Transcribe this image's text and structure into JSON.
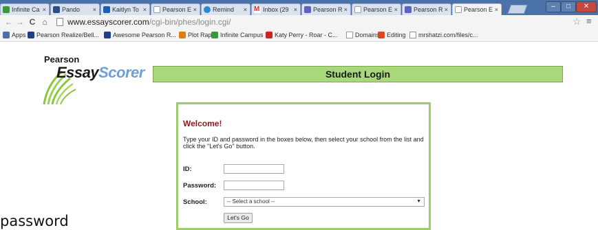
{
  "browser": {
    "tabs": [
      {
        "label": "Infinite Ca",
        "icon": "infinite-campus-icon",
        "color": "#3a9a3a"
      },
      {
        "label": "Pando",
        "icon": "pandora-icon",
        "color": "#2b4f8c"
      },
      {
        "label": "Kaitlyn To",
        "icon": "outlook-icon",
        "color": "#1a5fb4"
      },
      {
        "label": "Pearson E",
        "icon": "page-icon",
        "color": "#ffffff"
      },
      {
        "label": "Remind",
        "icon": "remind-icon",
        "color": "#2a8ad8"
      },
      {
        "label": "Inbox (29",
        "icon": "gmail-icon",
        "color": "#d93025"
      },
      {
        "label": "Pearson R",
        "icon": "pearson-realize-icon",
        "color": "#5b62c4"
      },
      {
        "label": "Pearson E",
        "icon": "page-icon",
        "color": "#ffffff"
      },
      {
        "label": "Pearson R",
        "icon": "pearson-realize-icon",
        "color": "#5b62c4"
      },
      {
        "label": "Pearson E",
        "icon": "page-icon",
        "color": "#ffffff"
      }
    ],
    "url_host": "www.essayscorer.com",
    "url_path": "/cgi-bin/phes/login.cgi/",
    "bookmarks": [
      {
        "label": "Apps",
        "icon": "apps-grid-icon",
        "color": "#4a72a8"
      },
      {
        "label": "Pearson Realize/Bell...",
        "icon": "pearson-icon",
        "color": "#1f3f8a"
      },
      {
        "label": "Awesome Pearson R...",
        "icon": "pearson-icon",
        "color": "#1f3f8a"
      },
      {
        "label": "Plot Rap",
        "icon": "plotrap-icon",
        "color": "#e07b12"
      },
      {
        "label": "Infinite Campus",
        "icon": "infinite-campus-icon",
        "color": "#3a9a3a"
      },
      {
        "label": "Katy Perry - Roar - C...",
        "icon": "youtube-icon",
        "color": "#d02020"
      },
      {
        "label": "Domains",
        "icon": "page-icon",
        "color": "#ffffff"
      },
      {
        "label": "Editing",
        "icon": "editing-icon",
        "color": "#d84a1a"
      },
      {
        "label": "mrshatzi.com/files/c...",
        "icon": "page-icon",
        "color": "#ffffff"
      }
    ]
  },
  "page": {
    "logo_top": "Pearson",
    "logo_essay": "Essay",
    "logo_scorer": "Scorer",
    "header_title": "Student Login",
    "welcome": "Welcome!",
    "instructions": "Type your ID and password in the boxes below, then select your school from the list and click the \"Let's Go\" button.",
    "id_label": "ID:",
    "password_label": "Password:",
    "school_label": "School:",
    "school_selected": "-- Select a school --",
    "go_button": "Let's Go"
  },
  "overlay": {
    "text": "password"
  },
  "colors": {
    "header_green": "#a8d87a",
    "box_border": "#9ccc6e",
    "welcome_red": "#8b1a1a",
    "logo_blue": "#6f9fd8",
    "titlebar_blue": "#4a72a8"
  }
}
